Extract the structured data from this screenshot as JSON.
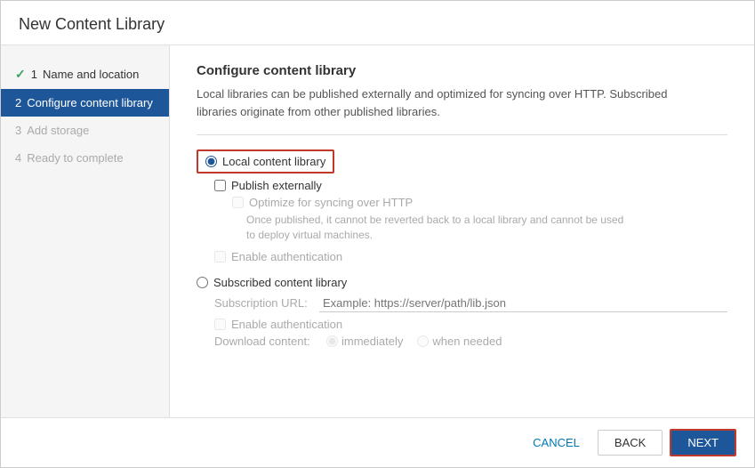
{
  "dialog": {
    "title": "New Content Library"
  },
  "sidebar": {
    "steps": [
      {
        "id": "step1",
        "number": "1",
        "label": "Name and location",
        "state": "completed"
      },
      {
        "id": "step2",
        "number": "2",
        "label": "Configure content library",
        "state": "active"
      },
      {
        "id": "step3",
        "number": "3",
        "label": "Add storage",
        "state": "disabled"
      },
      {
        "id": "step4",
        "number": "4",
        "label": "Ready to complete",
        "state": "disabled"
      }
    ]
  },
  "main": {
    "section_title": "Configure content library",
    "section_desc_line1": "Local libraries can be published externally and optimized for syncing over HTTP. Subscribed",
    "section_desc_line2": "libraries originate from other published libraries.",
    "local_library_label": "Local content library",
    "publish_externally_label": "Publish externally",
    "optimize_http_label": "Optimize for syncing over HTTP",
    "optimize_note_line1": "Once published, it cannot be reverted back to a local library and cannot be used",
    "optimize_note_line2": "to deploy virtual machines.",
    "enable_auth_local_label": "Enable authentication",
    "subscribed_library_label": "Subscribed content library",
    "subscription_url_label": "Subscription URL:",
    "subscription_url_placeholder": "Example: https://server/path/lib.json",
    "enable_auth_sub_label": "Enable authentication",
    "download_content_label": "Download content:",
    "immediately_label": "immediately",
    "when_needed_label": "when needed"
  },
  "footer": {
    "cancel_label": "CANCEL",
    "back_label": "BACK",
    "next_label": "NEXT"
  },
  "colors": {
    "active_step_bg": "#1e5799",
    "accent": "#c0392b",
    "link": "#0077b5",
    "check_green": "#3ea05f"
  }
}
